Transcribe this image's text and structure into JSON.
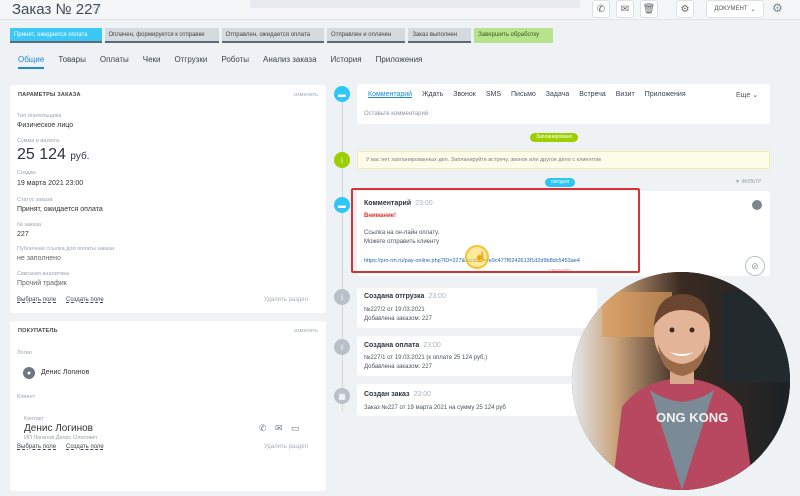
{
  "header": {
    "title": "Заказ № 227",
    "doc_button": "ДОКУМЕНТ"
  },
  "stages": [
    {
      "label": "Принят, ожидается оплата",
      "state": "active"
    },
    {
      "label": "Оплачен, формируется к отправке",
      "state": "grey"
    },
    {
      "label": "Отправлен, ожидается оплата",
      "state": "grey"
    },
    {
      "label": "Отправлен и оплачен",
      "state": "grey"
    },
    {
      "label": "Заказ выполнен",
      "state": "grey"
    },
    {
      "label": "Завершить обработку",
      "state": "green"
    }
  ],
  "tabs": [
    "Общие",
    "Товары",
    "Оплаты",
    "Чеки",
    "Отгрузки",
    "Роботы",
    "Анализ заказа",
    "История",
    "Приложения"
  ],
  "params": {
    "heading": "ПАРАМЕТРЫ ЗАКАЗА",
    "edit": "изменить",
    "payer_label": "Тип плательщика",
    "payer_value": "Физическое лицо",
    "sum_label": "Сумма и валюта",
    "sum_value": "25 124",
    "currency": "руб.",
    "created_label": "Создан",
    "created_value": "19 марта 2021 23:00",
    "status_label": "Статус заказа",
    "status_value": "Принят, ожидается оплата",
    "num_label": "№ заказа",
    "num_value": "227",
    "public_label": "Публичная ссылка для оплаты заказа",
    "public_value": "не заполнено",
    "analytics_label": "Сквозная аналитика",
    "analytics_value": "Прочий трафик",
    "choose_field": "Выбрать поле",
    "create_field": "Создать поле",
    "delete_section": "Удалить раздел"
  },
  "buyer": {
    "heading": "ПОКУПАТЕЛЬ",
    "edit": "изменить",
    "login_label": "Логин",
    "login_value": "Денис Логинов",
    "client_label": "Клиент",
    "contact_label": "Контакт",
    "contact_name": "Денис Логинов",
    "contact_sub": "ИП Логинов Денис Олегович",
    "choose_field": "Выбрать поле",
    "create_field": "Создать поле",
    "delete_section": "Удалить раздел"
  },
  "timeline": {
    "comment_tabs": [
      "Комментарий",
      "Ждать",
      "Звонок",
      "SMS",
      "Письмо",
      "Задача",
      "Встреча",
      "Визит",
      "Приложения"
    ],
    "more": "Еще",
    "placeholder": "Оставьте комментарий",
    "planned_pill": "Запланировано",
    "notice": "У вас нет запланированных дел. Запланируйте встречу, звонок или другое дело с клиентом",
    "today_pill": "сегодня",
    "filter": "ФИЛЬТР",
    "comment": {
      "title": "Комментарий",
      "time": "23:00",
      "attention": "Внимание!",
      "line1": "Ссылка на он-лайн оплату.",
      "line2": "Можете отправить клиенту",
      "link": "https://pro-rm.ru/pay-online.php?ID=227&access=4e9c477f6242613f1d2d9b8dc5453ae4",
      "collapse": "свернуть"
    },
    "shipment": {
      "title": "Создана отгрузка",
      "time": "23:00",
      "line1": "№227/2 от 19.03.2021",
      "line2": "Добавлена заказом: 227"
    },
    "payment": {
      "title": "Создана оплата",
      "time": "23:00",
      "line1": "№227/1 от 19.03.2021 (к оплате 25 124 руб.)",
      "line2": "Добавлена заказом: 227"
    },
    "order": {
      "title": "Создан заказ",
      "time": "23:00",
      "line1": "Заказ №227 от 19 марта 2021 на сумму 25 124 руб"
    }
  },
  "video": {
    "shirt_text": "ONG KONG"
  }
}
